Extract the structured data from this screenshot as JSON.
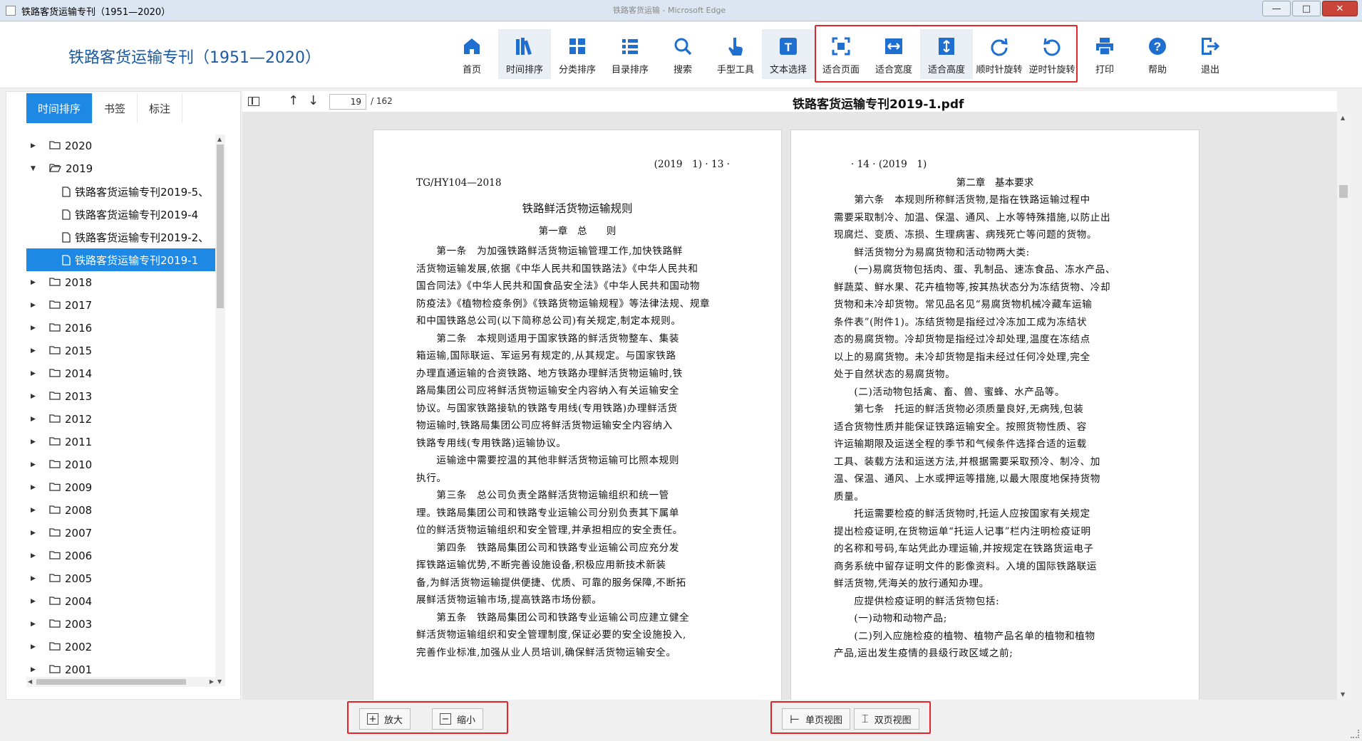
{
  "window": {
    "title": "铁路客货运输专刊（1951—2020）",
    "center_title": "铁路客货运输 - Microsoft Edge",
    "minimize": "—",
    "maximize": "□",
    "close": "✕"
  },
  "header": {
    "app_title": "铁路客货运输专刊（1951—2020）"
  },
  "toolbar": [
    {
      "label": "首页",
      "icon": "home-icon"
    },
    {
      "label": "时间排序",
      "icon": "books-icon"
    },
    {
      "label": "分类排序",
      "icon": "grid-icon"
    },
    {
      "label": "目录排序",
      "icon": "list-icon"
    },
    {
      "label": "搜索",
      "icon": "search-icon"
    },
    {
      "label": "手型工具",
      "icon": "hand-icon"
    },
    {
      "label": "文本选择",
      "icon": "text-select-icon"
    },
    {
      "label": "适合页面",
      "icon": "fit-page-icon"
    },
    {
      "label": "适合宽度",
      "icon": "fit-width-icon"
    },
    {
      "label": "适合高度",
      "icon": "fit-height-icon"
    },
    {
      "label": "顺时针旋转",
      "icon": "rotate-cw-icon"
    },
    {
      "label": "逆时针旋转",
      "icon": "rotate-ccw-icon"
    },
    {
      "label": "打印",
      "icon": "print-icon"
    },
    {
      "label": "帮助",
      "icon": "help-icon"
    },
    {
      "label": "退出",
      "icon": "exit-icon"
    }
  ],
  "sidebar": {
    "tabs": [
      "时间排序",
      "书签",
      "标注"
    ],
    "tree": [
      {
        "label": "2020",
        "type": "year",
        "expanded": false
      },
      {
        "label": "2019",
        "type": "year",
        "expanded": true
      },
      {
        "label": "铁路客货运输专刊2019-5、",
        "type": "file"
      },
      {
        "label": "铁路客货运输专刊2019-4",
        "type": "file"
      },
      {
        "label": "铁路客货运输专刊2019-2、",
        "type": "file"
      },
      {
        "label": "铁路客货运输专刊2019-1",
        "type": "file",
        "selected": true
      },
      {
        "label": "2018",
        "type": "year"
      },
      {
        "label": "2017",
        "type": "year"
      },
      {
        "label": "2016",
        "type": "year"
      },
      {
        "label": "2015",
        "type": "year"
      },
      {
        "label": "2014",
        "type": "year"
      },
      {
        "label": "2013",
        "type": "year"
      },
      {
        "label": "2012",
        "type": "year"
      },
      {
        "label": "2011",
        "type": "year"
      },
      {
        "label": "2010",
        "type": "year"
      },
      {
        "label": "2009",
        "type": "year"
      },
      {
        "label": "2008",
        "type": "year"
      },
      {
        "label": "2007",
        "type": "year"
      },
      {
        "label": "2006",
        "type": "year"
      },
      {
        "label": "2005",
        "type": "year"
      },
      {
        "label": "2004",
        "type": "year"
      },
      {
        "label": "2003",
        "type": "year"
      },
      {
        "label": "2002",
        "type": "year"
      },
      {
        "label": "2001",
        "type": "year"
      }
    ]
  },
  "viewer": {
    "page_number": "19",
    "page_total": "/ 162",
    "file_title": "铁路客货运输专刊2019-1.pdf",
    "left_page": {
      "header": "(2019　1) · 13 ·",
      "code": "TG/HY104—2018",
      "title": "铁路鲜活货物运输规则",
      "chapter": "第一章　总　　则",
      "lines": [
        "　　第一条　为加强铁路鲜活货物运输管理工作,加快铁路鲜",
        "活货物运输发展,依据《中华人民共和国铁路法》《中华人民共和",
        "国合同法》《中华人民共和国食品安全法》《中华人民共和国动物",
        "防疫法》《植物检疫条例》《铁路货物运输规程》等法律法规、规章",
        "和中国铁路总公司(以下简称总公司)有关规定,制定本规则。",
        "　　第二条　本规则适用于国家铁路的鲜活货物整车、集装",
        "箱运输,国际联运、军运另有规定的,从其规定。与国家铁路",
        "办理直通运输的合资铁路、地方铁路办理鲜活货物运输时,铁",
        "路局集团公司应将鲜活货物运输安全内容纳入有关运输安全",
        "协议。与国家铁路接轨的铁路专用线(专用铁路)办理鲜活货",
        "物运输时,铁路局集团公司应将鲜活货物运输安全内容纳入",
        "铁路专用线(专用铁路)运输协议。",
        "　　运输途中需要控温的其他非鲜活货物运输可比照本规则",
        "执行。",
        "　　第三条　总公司负责全路鲜活货物运输组织和统一管",
        "理。铁路局集团公司和铁路专业运输公司分别负责其下属单",
        "位的鲜活货物运输组织和安全管理,并承担相应的安全责任。",
        "　　第四条　铁路局集团公司和铁路专业运输公司应充分发",
        "挥铁路运输优势,不断完善设施设备,积极应用新技术新装",
        "备,为鲜活货物运输提供便捷、优质、可靠的服务保障,不断拓",
        "展鲜活货物运输市场,提高铁路市场份额。",
        "　　第五条　铁路局集团公司和铁路专业运输公司应建立健全",
        "鲜活货物运输组织和安全管理制度,保证必要的安全设施投入,",
        "完善作业标准,加强从业人员培训,确保鲜活货物运输安全。"
      ]
    },
    "right_page": {
      "header": "· 14 · (2019　1)",
      "chapter": "第二章　基本要求",
      "lines": [
        "　　第六条　本规则所称鲜活货物,是指在铁路运输过程中",
        "需要采取制冷、加温、保温、通风、上水等特殊措施,以防止出",
        "现腐烂、变质、冻损、生理病害、病残死亡等问题的货物。",
        "　　鲜活货物分为易腐货物和活动物两大类:",
        "　　(一)易腐货物包括肉、蛋、乳制品、速冻食品、冻水产品、",
        "鲜蔬菜、鲜水果、花卉植物等,按其热状态分为冻结货物、冷却",
        "货物和未冷却货物。常见品名见“易腐货物机械冷藏车运输",
        "条件表”(附件1)。冻结货物是指经过冷冻加工成为冻结状",
        "态的易腐货物。冷却货物是指经过冷却处理,温度在冻结点",
        "以上的易腐货物。未冷却货物是指未经过任何冷处理,完全",
        "处于自然状态的易腐货物。",
        "　　(二)活动物包括禽、畜、兽、蜜蜂、水产品等。",
        "　　第七条　托运的鲜活货物必须质量良好,无病残,包装",
        "适合货物性质并能保证铁路运输安全。按照货物性质、容",
        "许运输期限及运送全程的季节和气候条件选择合适的运载",
        "工具、装载方法和运送方法,并根据需要采取预冷、制冷、加",
        "温、保温、通风、上水或押运等措施,以最大限度地保持货物",
        "质量。",
        "　　托运需要检疫的鲜活货物时,托运人应按国家有关规定",
        "提出检疫证明,在货物运单“托运人记事”栏内注明检疫证明",
        "的名称和号码,车站凭此办理运输,并按规定在铁路货运电子",
        "商务系统中留存证明文件的影像资料。入境的国际铁路联运",
        "鲜活货物,凭海关的放行通知办理。",
        "　　应提供检疫证明的鲜活货物包括:",
        "　　(一)动物和动物产品;",
        "　　(二)列入应施检疫的植物、植物产品名单的植物和植物",
        "产品,运出发生疫情的县级行政区域之前;"
      ]
    }
  },
  "bottom": {
    "zoom_in": "放大",
    "zoom_out": "缩小",
    "single_page": "单页视图",
    "double_page": "双页视图"
  },
  "colors": {
    "accent": "#1e88e5",
    "title_blue": "#1c5aa0",
    "highlight_red": "#e3242b"
  }
}
